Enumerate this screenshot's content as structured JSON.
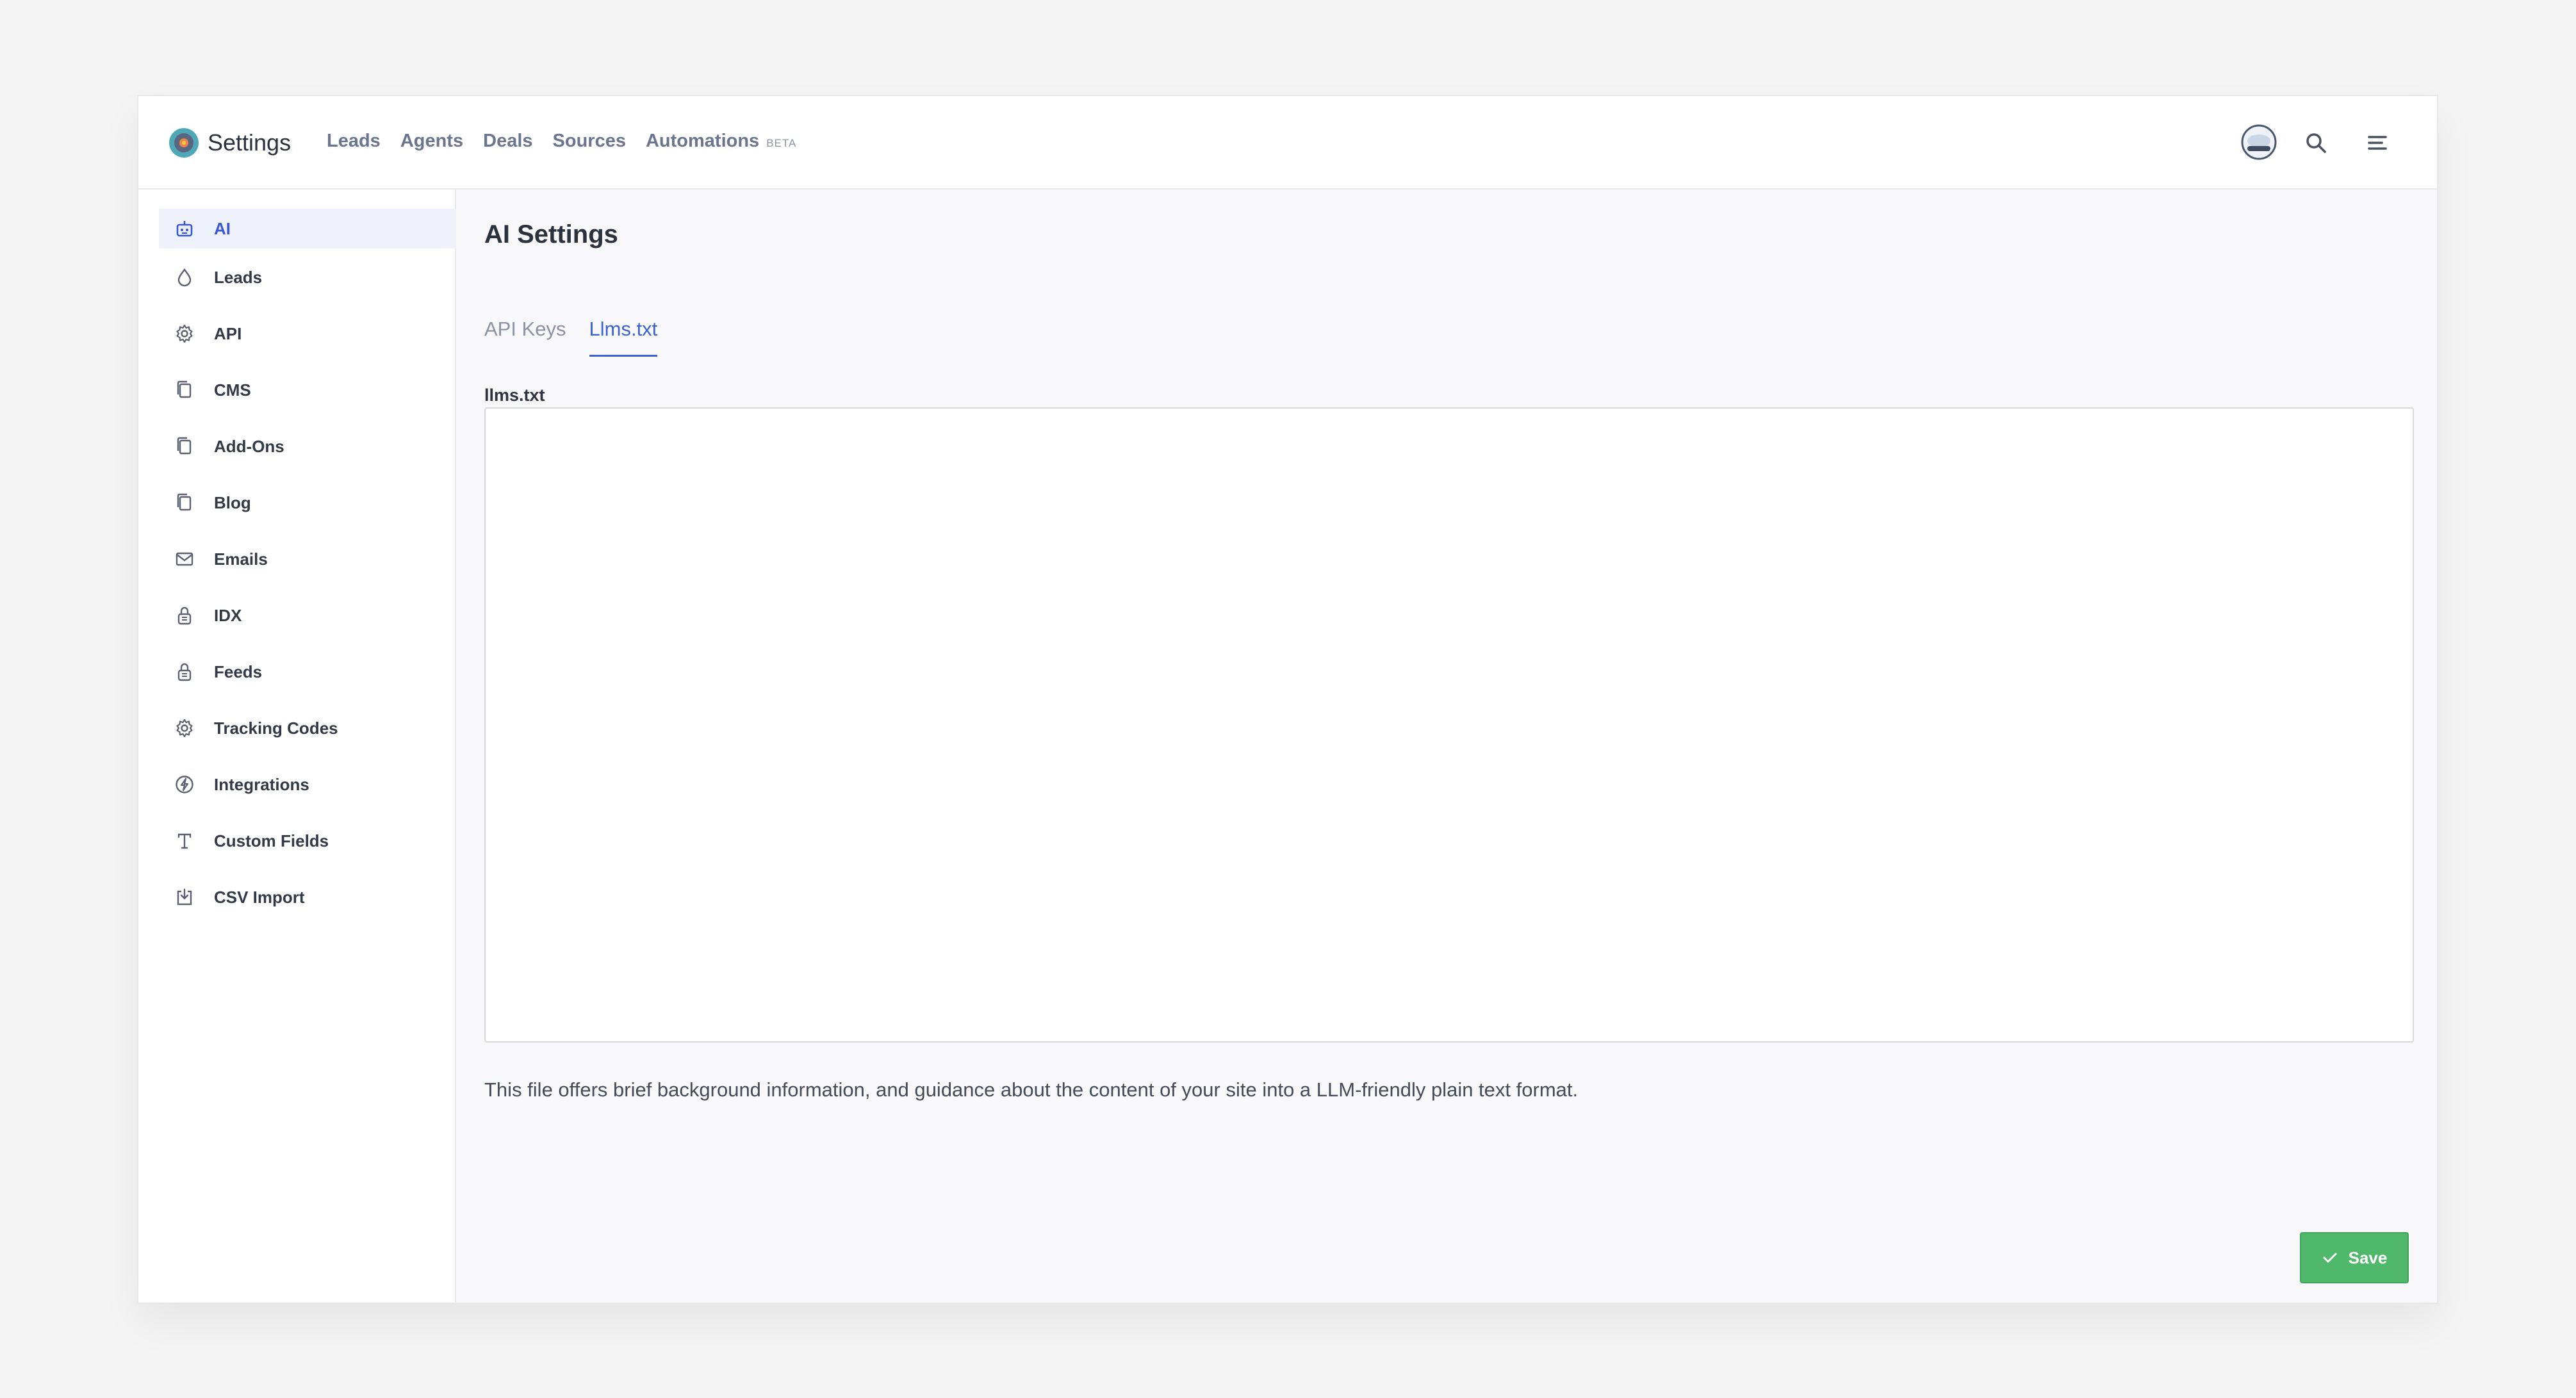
{
  "header": {
    "app_title": "Settings",
    "nav": [
      {
        "label": "Leads"
      },
      {
        "label": "Agents"
      },
      {
        "label": "Deals"
      },
      {
        "label": "Sources"
      },
      {
        "label": "Automations",
        "badge": "BETA"
      }
    ],
    "icons": [
      "settings-logo-icon",
      "user-avatar",
      "search-icon",
      "menu-icon"
    ]
  },
  "sidebar": {
    "items": [
      {
        "label": "AI",
        "icon": "robot-icon",
        "active": true
      },
      {
        "label": "Leads",
        "icon": "drop-icon"
      },
      {
        "label": "API",
        "icon": "gear-icon"
      },
      {
        "label": "CMS",
        "icon": "pages-icon"
      },
      {
        "label": "Add-Ons",
        "icon": "pages-icon"
      },
      {
        "label": "Blog",
        "icon": "pages-icon"
      },
      {
        "label": "Emails",
        "icon": "mail-icon"
      },
      {
        "label": "IDX",
        "icon": "lock-icon"
      },
      {
        "label": "Feeds",
        "icon": "lock-icon"
      },
      {
        "label": "Tracking Codes",
        "icon": "gear-icon"
      },
      {
        "label": "Integrations",
        "icon": "bolt-icon"
      },
      {
        "label": "Custom Fields",
        "icon": "text-icon"
      },
      {
        "label": "CSV Import",
        "icon": "import-icon"
      }
    ]
  },
  "main": {
    "title": "AI Settings",
    "tabs": [
      {
        "label": "API Keys",
        "active": false
      },
      {
        "label": "Llms.txt",
        "active": true
      }
    ],
    "field_label": "llms.txt",
    "field_value": "",
    "help_text": "This file offers brief background information, and guidance about the content of your site into a LLM-friendly plain text format.",
    "save_label": "Save"
  },
  "colors": {
    "accent": "#3b63d6",
    "save": "#4fb86b",
    "sidebar_active_bg": "#eef0fa"
  }
}
